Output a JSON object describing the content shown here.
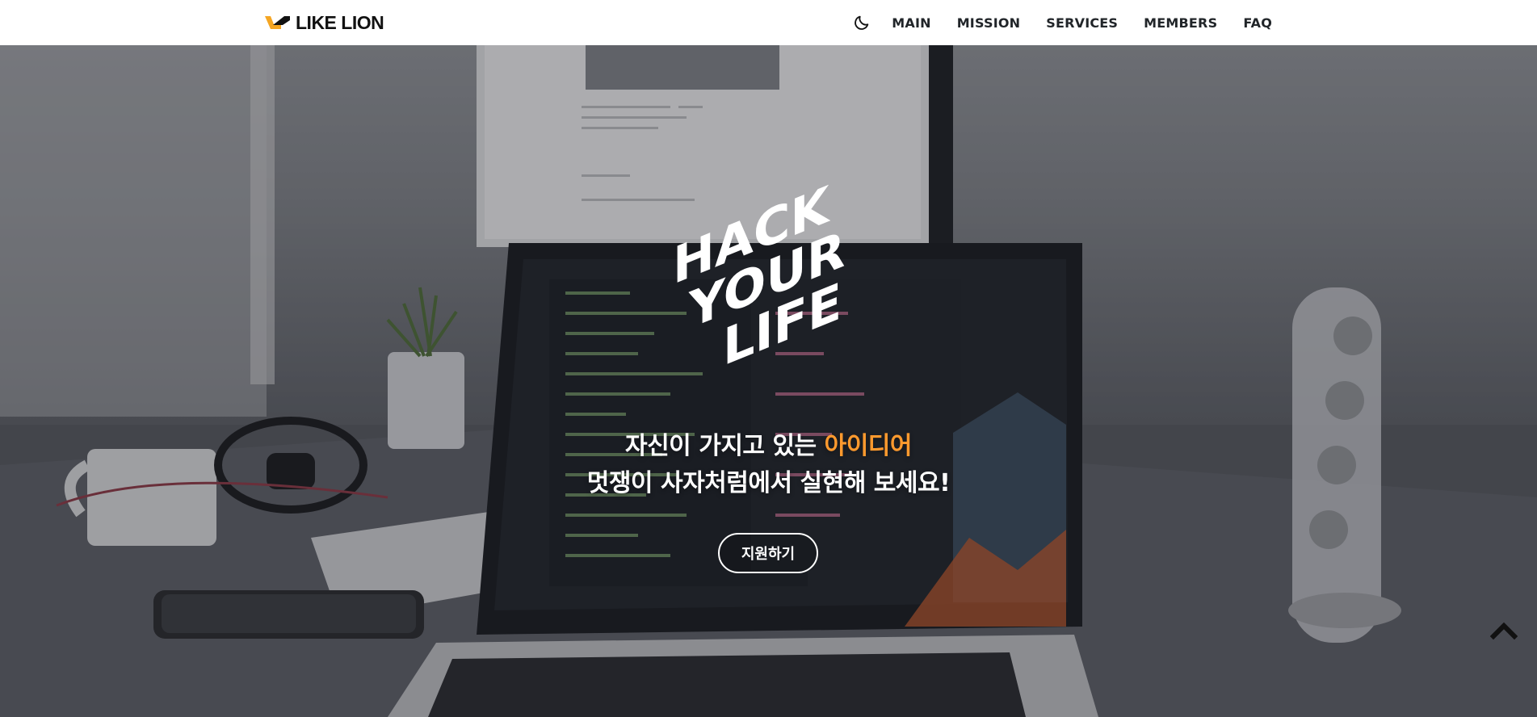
{
  "header": {
    "logo_text": "LIKE LION",
    "logo_icon": "likelion-mark-icon",
    "theme_toggle_icon": "moon-icon",
    "nav": [
      {
        "label": "MAIN"
      },
      {
        "label": "MISSION"
      },
      {
        "label": "SERVICES"
      },
      {
        "label": "MEMBERS"
      },
      {
        "label": "FAQ"
      }
    ]
  },
  "hero": {
    "logo_lines": [
      "HACK",
      "YOUR",
      "LIFE"
    ],
    "title_line1_prefix": "자신이 가지고 있는 ",
    "title_line1_accent": "아이디어",
    "title_line2": "멋쟁이 사자처럼에서 실현해 보세요!",
    "apply_label": "지원하기",
    "scroll_top_icon": "chevron-up-icon"
  },
  "colors": {
    "accent": "#ff9a2e",
    "logo_accent": "#f5a623",
    "header_bg": "#ffffff",
    "nav_text": "#212529"
  }
}
